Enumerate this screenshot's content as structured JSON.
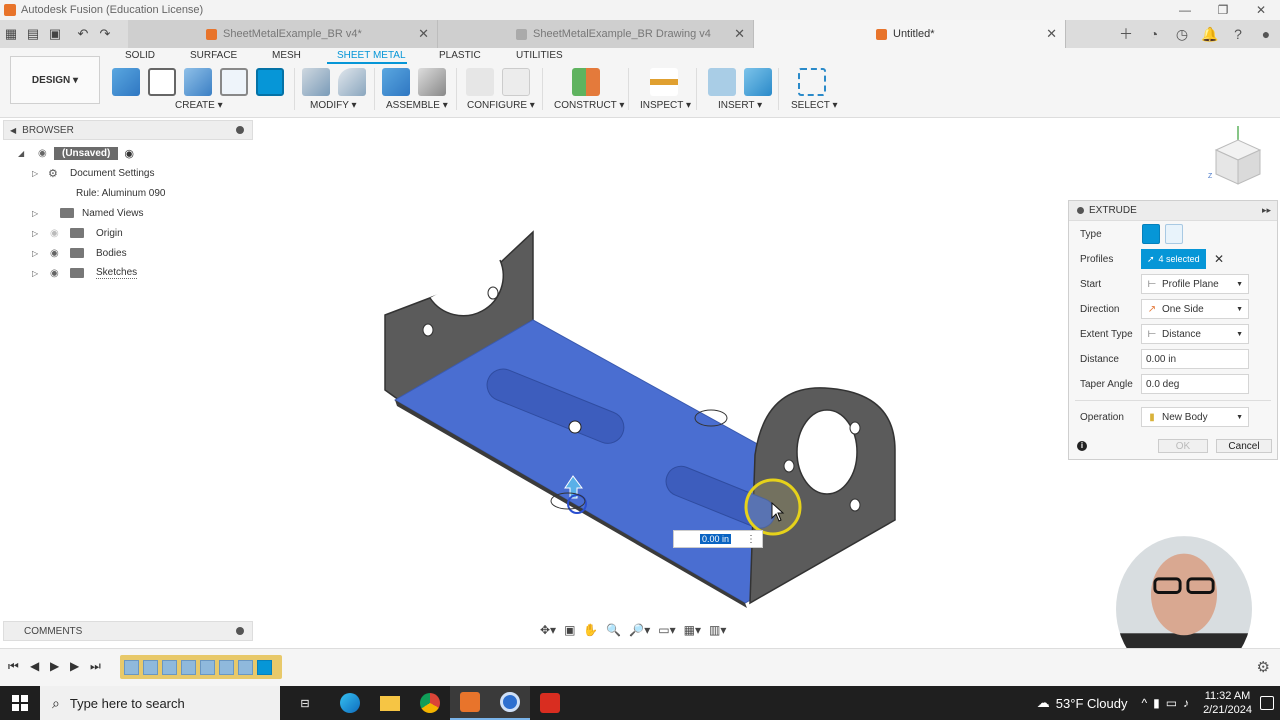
{
  "window": {
    "title": "Autodesk Fusion (Education License)"
  },
  "tabs": [
    {
      "label": "SheetMetalExample_BR v4*",
      "color": "#e8742b",
      "active": false
    },
    {
      "label": "SheetMetalExample_BR Drawing v4",
      "color": "#aaaaaa",
      "active": false
    },
    {
      "label": "Untitled*",
      "color": "#e8742b",
      "active": true
    }
  ],
  "ribbon": {
    "design_label": "DESIGN ▾",
    "tabs": [
      "SOLID",
      "SURFACE",
      "MESH",
      "SHEET METAL",
      "PLASTIC",
      "UTILITIES"
    ],
    "active_tab": "SHEET METAL",
    "groups": [
      "CREATE ▾",
      "MODIFY ▾",
      "ASSEMBLE ▾",
      "CONFIGURE ▾",
      "CONSTRUCT ▾",
      "INSPECT ▾",
      "INSERT ▾",
      "SELECT ▾"
    ]
  },
  "browser": {
    "title": "BROWSER",
    "root": "(Unsaved)",
    "items": [
      {
        "label": "Document Settings",
        "icon": "gear-icon"
      },
      {
        "label": "Rule: Aluminum 090",
        "icon": "none"
      },
      {
        "label": "Named Views",
        "icon": "folder-icon"
      },
      {
        "label": "Origin",
        "icon": "folder-icon"
      },
      {
        "label": "Bodies",
        "icon": "folder-icon"
      },
      {
        "label": "Sketches",
        "icon": "folder-icon"
      }
    ]
  },
  "comments": {
    "label": "COMMENTS"
  },
  "extrude": {
    "title": "EXTRUDE",
    "rows": {
      "type": {
        "label": "Type"
      },
      "profiles": {
        "label": "Profiles",
        "value": "4 selected"
      },
      "start": {
        "label": "Start",
        "value": "Profile Plane"
      },
      "direction": {
        "label": "Direction",
        "value": "One Side"
      },
      "extent_type": {
        "label": "Extent Type",
        "value": "Distance"
      },
      "distance": {
        "label": "Distance",
        "value": "0.00 in"
      },
      "taper": {
        "label": "Taper Angle",
        "value": "0.0 deg"
      },
      "operation": {
        "label": "Operation",
        "value": "New Body"
      }
    },
    "ok_label": "OK",
    "cancel_label": "Cancel"
  },
  "viewport": {
    "distance_input": "0.00 in"
  },
  "taskbar": {
    "search_placeholder": "Type here to search",
    "weather": "53°F  Cloudy",
    "time": "11:32 AM",
    "date": "2/21/2024"
  },
  "colors": {
    "accent": "#0696d7",
    "selection_blue": "#4a6ed1",
    "part_grey": "#5a5a5a"
  }
}
